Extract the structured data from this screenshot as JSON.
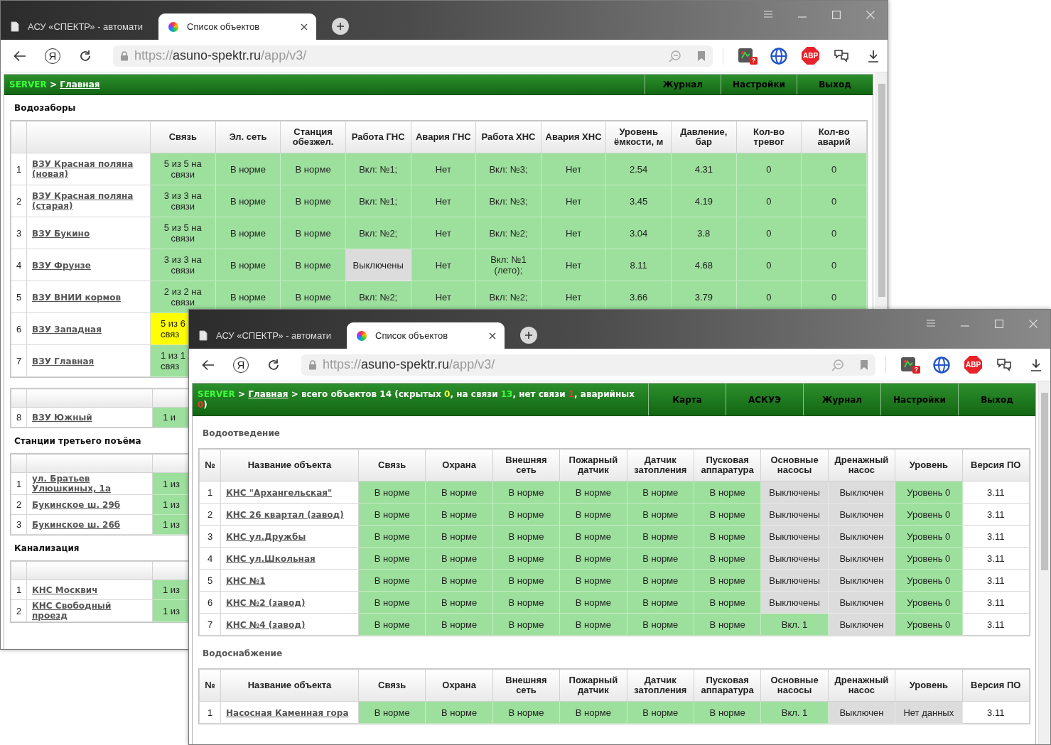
{
  "windows": [
    {
      "tabs": [
        {
          "kind": "page",
          "title": "АСУ «СПЕКТР» - автомати",
          "selected": false
        },
        {
          "kind": "color-wheel",
          "title": "Список объектов",
          "selected": true
        }
      ],
      "logo_button": "Я",
      "url": {
        "scheme": "https://",
        "host": "asuno-spektr.ru",
        "path": "/app/v3/"
      },
      "extensions": [
        {
          "kind": "app",
          "badge": "?"
        },
        {
          "kind": "globe"
        },
        {
          "kind": "adblock",
          "label": "ABP"
        },
        {
          "kind": "chat"
        }
      ],
      "breadcrumb": [
        {
          "kind": "server",
          "text": "SERVER"
        },
        {
          "kind": "text",
          "text": " > "
        },
        {
          "kind": "link",
          "text": "Главная"
        }
      ],
      "nav": [
        "Журнал",
        "Настройки",
        "Выход"
      ],
      "sections": [
        {
          "title": "Водозаборы",
          "columns": [
            "Связь",
            "Эл. сеть",
            "Станция обезжел.",
            "Работа ГНС",
            "Авария ГНС",
            "Работа ХНС",
            "Авария ХНС",
            "Уровень ёмкости, м",
            "Давление, бар",
            "Кол-во тревог",
            "Кол-во аварий"
          ],
          "rows": [
            {
              "number": "1",
              "name": "ВЗУ Красная поляна (новая)",
              "cells": [
                {
                  "text": "5 из 5 на связи",
                  "kind": "ok"
                },
                {
                  "text": "В норме",
                  "kind": "ok"
                },
                {
                  "text": "В норме",
                  "kind": "ok"
                },
                {
                  "text": "Вкл: №1;",
                  "kind": "ok"
                },
                {
                  "text": "Нет",
                  "kind": "ok"
                },
                {
                  "text": "Вкл: №3;",
                  "kind": "ok"
                },
                {
                  "text": "Нет",
                  "kind": "ok"
                },
                {
                  "text": "2.54",
                  "kind": "ok"
                },
                {
                  "text": "4.31",
                  "kind": "ok"
                },
                {
                  "text": "0",
                  "kind": "ok"
                },
                {
                  "text": "0",
                  "kind": "ok"
                }
              ]
            },
            {
              "number": "2",
              "name": "ВЗУ Красная поляна (старая)",
              "cells": [
                {
                  "text": "3 из 3 на связи",
                  "kind": "ok"
                },
                {
                  "text": "В норме",
                  "kind": "ok"
                },
                {
                  "text": "В норме",
                  "kind": "ok"
                },
                {
                  "text": "Вкл: №1;",
                  "kind": "ok"
                },
                {
                  "text": "Нет",
                  "kind": "ok"
                },
                {
                  "text": "Вкл: №3;",
                  "kind": "ok"
                },
                {
                  "text": "Нет",
                  "kind": "ok"
                },
                {
                  "text": "3.45",
                  "kind": "ok"
                },
                {
                  "text": "4.19",
                  "kind": "ok"
                },
                {
                  "text": "0",
                  "kind": "ok"
                },
                {
                  "text": "0",
                  "kind": "ok"
                }
              ]
            },
            {
              "number": "3",
              "name": "ВЗУ Букино",
              "cells": [
                {
                  "text": "5 из 5 на связи",
                  "kind": "ok"
                },
                {
                  "text": "В норме",
                  "kind": "ok"
                },
                {
                  "text": "В норме",
                  "kind": "ok"
                },
                {
                  "text": "Вкл: №2;",
                  "kind": "ok"
                },
                {
                  "text": "Нет",
                  "kind": "ok"
                },
                {
                  "text": "Вкл: №2;",
                  "kind": "ok"
                },
                {
                  "text": "Нет",
                  "kind": "ok"
                },
                {
                  "text": "3.04",
                  "kind": "ok"
                },
                {
                  "text": "3.8",
                  "kind": "ok"
                },
                {
                  "text": "0",
                  "kind": "ok"
                },
                {
                  "text": "0",
                  "kind": "ok"
                }
              ]
            },
            {
              "number": "4",
              "name": "ВЗУ Фрунзе",
              "cells": [
                {
                  "text": "3 из 3 на связи",
                  "kind": "ok"
                },
                {
                  "text": "В норме",
                  "kind": "ok"
                },
                {
                  "text": "В норме",
                  "kind": "ok"
                },
                {
                  "text": "Выключены",
                  "kind": "off"
                },
                {
                  "text": "Нет",
                  "kind": "ok"
                },
                {
                  "text": "Вкл: №1 (лето);",
                  "kind": "ok"
                },
                {
                  "text": "Нет",
                  "kind": "ok"
                },
                {
                  "text": "8.11",
                  "kind": "ok"
                },
                {
                  "text": "4.68",
                  "kind": "ok"
                },
                {
                  "text": "0",
                  "kind": "ok"
                },
                {
                  "text": "0",
                  "kind": "ok"
                }
              ]
            },
            {
              "number": "5",
              "name": "ВЗУ ВНИИ кормов",
              "cells": [
                {
                  "text": "2 из 2 на связи",
                  "kind": "ok"
                },
                {
                  "text": "В норме",
                  "kind": "ok"
                },
                {
                  "text": "В норме",
                  "kind": "ok"
                },
                {
                  "text": "Вкл: №2;",
                  "kind": "ok"
                },
                {
                  "text": "Нет",
                  "kind": "ok"
                },
                {
                  "text": "Вкл: №2;",
                  "kind": "ok"
                },
                {
                  "text": "Нет",
                  "kind": "ok"
                },
                {
                  "text": "3.66",
                  "kind": "ok"
                },
                {
                  "text": "3.79",
                  "kind": "ok"
                },
                {
                  "text": "0",
                  "kind": "ok"
                },
                {
                  "text": "0",
                  "kind": "ok"
                }
              ]
            },
            {
              "number": "6",
              "name": "ВЗУ Западная",
              "cells": [
                {
                  "text": "5 из 6 связ",
                  "kind": "warn"
                }
              ]
            },
            {
              "number": "7",
              "name": "ВЗУ Главная",
              "cells": [
                {
                  "text": "1 из 1 связ",
                  "kind": "ok"
                }
              ]
            }
          ]
        },
        {
          "rows": [
            {
              "number": "8",
              "name": "ВЗУ Южный",
              "cells": [
                {
                  "text": "1 и",
                  "kind": "ok"
                }
              ]
            }
          ]
        },
        {
          "title": "Станции третьего поъёма",
          "rows": [
            {
              "number": "1",
              "name": "ул. Братьев Улюшкиных, 1а",
              "cells": [
                {
                  "text": "1 из",
                  "kind": "ok"
                }
              ]
            },
            {
              "number": "2",
              "name": "Букинское ш. 29б",
              "cells": [
                {
                  "text": "1 из",
                  "kind": "ok"
                }
              ]
            },
            {
              "number": "3",
              "name": "Букинское ш. 26б",
              "cells": [
                {
                  "text": "1 из",
                  "kind": "ok"
                }
              ]
            }
          ]
        },
        {
          "title": "Канализация",
          "rows": [
            {
              "number": "1",
              "name": "КНС Москвич",
              "cells": [
                {
                  "text": "1 из",
                  "kind": "ok"
                }
              ]
            },
            {
              "number": "2",
              "name": "КНС Свободный проезд",
              "cells": [
                {
                  "text": "1 из",
                  "kind": "ok"
                }
              ]
            }
          ]
        }
      ]
    },
    {
      "tabs": [
        {
          "kind": "page",
          "title": "АСУ «СПЕКТР» - автомати",
          "selected": false
        },
        {
          "kind": "color-wheel",
          "title": "Список объектов",
          "selected": true
        }
      ],
      "logo_button": "Я",
      "url": {
        "scheme": "https://",
        "host": "asuno-spektr.ru",
        "path": "/app/v3/"
      },
      "extensions": [
        {
          "kind": "app",
          "badge": "?"
        },
        {
          "kind": "globe"
        },
        {
          "kind": "adblock",
          "label": "ABP"
        },
        {
          "kind": "chat"
        }
      ],
      "breadcrumb": [
        {
          "kind": "server",
          "text": "SERVER"
        },
        {
          "kind": "text",
          "text": " > "
        },
        {
          "kind": "link",
          "text": "Главная"
        },
        {
          "kind": "text",
          "text": " > всего объектов 14 (скрытых "
        },
        {
          "kind": "hidden-count",
          "text": "0"
        },
        {
          "kind": "text",
          "text": ", на связи "
        },
        {
          "kind": "online-count",
          "text": "13"
        },
        {
          "kind": "text",
          "text": ", нет связи "
        },
        {
          "kind": "offline-count",
          "text": "1"
        },
        {
          "kind": "text",
          "text": ", аварийных "
        },
        {
          "kind": "alarm-count",
          "text": "0"
        },
        {
          "kind": "text",
          "text": ")"
        }
      ],
      "nav": [
        "Карта",
        "АСКУЭ",
        "Журнал",
        "Настройки",
        "Выход"
      ],
      "sections": [
        {
          "title": "Водоотведение",
          "number_header": "№",
          "name_header": "Название объекта",
          "columns": [
            "Связь",
            "Охрана",
            "Внешняя сеть",
            "Пожарный датчик",
            "Датчик затопления",
            "Пусковая аппаратура",
            "Основные насосы",
            "Дренажный насос",
            "Уровень",
            "Версия ПО"
          ],
          "rows": [
            {
              "number": "1",
              "name": "КНС \"Архангельская\"",
              "cells": [
                {
                  "text": "В норме",
                  "kind": "ok"
                },
                {
                  "text": "В норме",
                  "kind": "ok"
                },
                {
                  "text": "В норме",
                  "kind": "ok"
                },
                {
                  "text": "В норме",
                  "kind": "ok"
                },
                {
                  "text": "В норме",
                  "kind": "ok"
                },
                {
                  "text": "В норме",
                  "kind": "ok"
                },
                {
                  "text": "Выключены",
                  "kind": "off"
                },
                {
                  "text": "Выключен",
                  "kind": "off"
                },
                {
                  "text": "Уровень 0",
                  "kind": "ok"
                },
                {
                  "text": "3.11",
                  "kind": "plain"
                }
              ]
            },
            {
              "number": "2",
              "name": "КНС 26 квартал (завод)",
              "cells": [
                {
                  "text": "В норме",
                  "kind": "ok"
                },
                {
                  "text": "В норме",
                  "kind": "ok"
                },
                {
                  "text": "В норме",
                  "kind": "ok"
                },
                {
                  "text": "В норме",
                  "kind": "ok"
                },
                {
                  "text": "В норме",
                  "kind": "ok"
                },
                {
                  "text": "В норме",
                  "kind": "ok"
                },
                {
                  "text": "Выключены",
                  "kind": "off"
                },
                {
                  "text": "Выключен",
                  "kind": "off"
                },
                {
                  "text": "Уровень 0",
                  "kind": "ok"
                },
                {
                  "text": "3.11",
                  "kind": "plain"
                }
              ]
            },
            {
              "number": "3",
              "name": "КНС ул.Дружбы",
              "cells": [
                {
                  "text": "В норме",
                  "kind": "ok"
                },
                {
                  "text": "В норме",
                  "kind": "ok"
                },
                {
                  "text": "В норме",
                  "kind": "ok"
                },
                {
                  "text": "В норме",
                  "kind": "ok"
                },
                {
                  "text": "В норме",
                  "kind": "ok"
                },
                {
                  "text": "В норме",
                  "kind": "ok"
                },
                {
                  "text": "Выключены",
                  "kind": "off"
                },
                {
                  "text": "Выключен",
                  "kind": "off"
                },
                {
                  "text": "Уровень 0",
                  "kind": "ok"
                },
                {
                  "text": "3.11",
                  "kind": "plain"
                }
              ]
            },
            {
              "number": "4",
              "name": "КНС ул.Школьная",
              "cells": [
                {
                  "text": "В норме",
                  "kind": "ok"
                },
                {
                  "text": "В норме",
                  "kind": "ok"
                },
                {
                  "text": "В норме",
                  "kind": "ok"
                },
                {
                  "text": "В норме",
                  "kind": "ok"
                },
                {
                  "text": "В норме",
                  "kind": "ok"
                },
                {
                  "text": "В норме",
                  "kind": "ok"
                },
                {
                  "text": "Выключены",
                  "kind": "off"
                },
                {
                  "text": "Выключен",
                  "kind": "off"
                },
                {
                  "text": "Уровень 0",
                  "kind": "ok"
                },
                {
                  "text": "3.11",
                  "kind": "plain"
                }
              ]
            },
            {
              "number": "5",
              "name": "КНС №1",
              "cells": [
                {
                  "text": "В норме",
                  "kind": "ok"
                },
                {
                  "text": "В норме",
                  "kind": "ok"
                },
                {
                  "text": "В норме",
                  "kind": "ok"
                },
                {
                  "text": "В норме",
                  "kind": "ok"
                },
                {
                  "text": "В норме",
                  "kind": "ok"
                },
                {
                  "text": "В норме",
                  "kind": "ok"
                },
                {
                  "text": "Выключены",
                  "kind": "off"
                },
                {
                  "text": "Выключен",
                  "kind": "off"
                },
                {
                  "text": "Уровень 0",
                  "kind": "ok"
                },
                {
                  "text": "3.11",
                  "kind": "plain"
                }
              ]
            },
            {
              "number": "6",
              "name": "КНС №2 (завод)",
              "cells": [
                {
                  "text": "В норме",
                  "kind": "ok"
                },
                {
                  "text": "В норме",
                  "kind": "ok"
                },
                {
                  "text": "В норме",
                  "kind": "ok"
                },
                {
                  "text": "В норме",
                  "kind": "ok"
                },
                {
                  "text": "В норме",
                  "kind": "ok"
                },
                {
                  "text": "В норме",
                  "kind": "ok"
                },
                {
                  "text": "Выключены",
                  "kind": "off"
                },
                {
                  "text": "Выключен",
                  "kind": "off"
                },
                {
                  "text": "Уровень 0",
                  "kind": "ok"
                },
                {
                  "text": "3.11",
                  "kind": "plain"
                }
              ]
            },
            {
              "number": "7",
              "name": "КНС №4 (завод)",
              "cells": [
                {
                  "text": "В норме",
                  "kind": "ok"
                },
                {
                  "text": "В норме",
                  "kind": "ok"
                },
                {
                  "text": "В норме",
                  "kind": "ok"
                },
                {
                  "text": "В норме",
                  "kind": "ok"
                },
                {
                  "text": "В норме",
                  "kind": "ok"
                },
                {
                  "text": "В норме",
                  "kind": "ok"
                },
                {
                  "text": "Вкл. 1",
                  "kind": "ok"
                },
                {
                  "text": "Выключен",
                  "kind": "off"
                },
                {
                  "text": "Уровень 0",
                  "kind": "ok"
                },
                {
                  "text": "3.11",
                  "kind": "plain"
                }
              ]
            }
          ]
        },
        {
          "title": "Водоснабжение",
          "number_header": "№",
          "name_header": "Название объекта",
          "columns": [
            "Связь",
            "Охрана",
            "Внешняя сеть",
            "Пожарный датчик",
            "Датчик затопления",
            "Пусковая аппаратура",
            "Основные насосы",
            "Дренажный насос",
            "Уровень",
            "Версия ПО"
          ],
          "rows": [
            {
              "number": "1",
              "name": "Насосная Каменная гора",
              "cells": [
                {
                  "text": "В норме",
                  "kind": "ok"
                },
                {
                  "text": "В норме",
                  "kind": "ok"
                },
                {
                  "text": "В норме",
                  "kind": "ok"
                },
                {
                  "text": "В норме",
                  "kind": "ok"
                },
                {
                  "text": "В норме",
                  "kind": "ok"
                },
                {
                  "text": "В норме",
                  "kind": "ok"
                },
                {
                  "text": "Вкл. 1",
                  "kind": "ok"
                },
                {
                  "text": "Выключен",
                  "kind": "off"
                },
                {
                  "text": "Нет данных",
                  "kind": "off"
                },
                {
                  "text": "3.11",
                  "kind": "plain"
                }
              ]
            }
          ]
        }
      ]
    }
  ]
}
